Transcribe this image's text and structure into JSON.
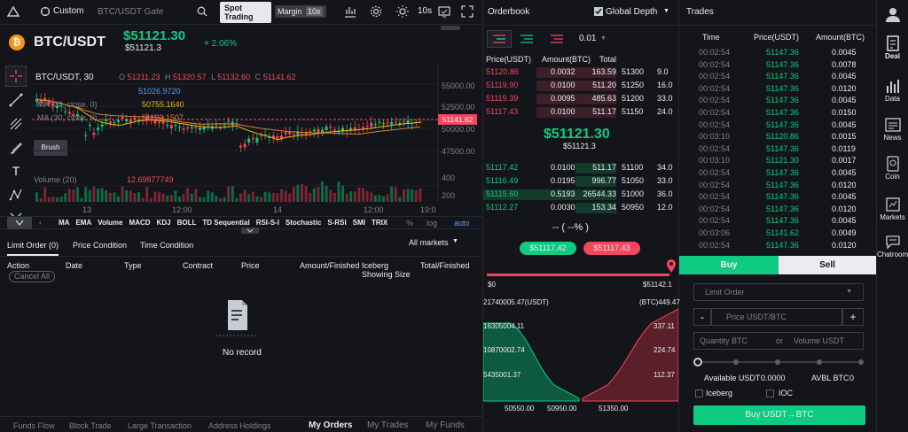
{
  "topbar": {
    "custom": "Custom",
    "symbol_search": "BTC/USDT Gate",
    "spot_trading": "Spot Trading",
    "margin": "Margin",
    "margin_badge": "10x",
    "interval": "10s"
  },
  "ticker": {
    "pair": "BTC/USDT",
    "price": "$51121.30",
    "sub": "$51121.3",
    "change": "+ 2.06%"
  },
  "chart": {
    "title": "BTC/USDT, 30",
    "o": "O",
    "o_val": "51211.23",
    "h": "H",
    "h_val": "51320.57",
    "l": "L",
    "l_val": "51132.60",
    "c": "C",
    "c_val": "51141.62",
    "ind1_val": "51026.9720",
    "ma10_label": "MA (10, close, 0)",
    "ma10_val": "50755.1640",
    "ma30_label": "MA (30, close, 0)",
    "ma30_val": "51129.1507",
    "vol_label": "Volume (20)",
    "vol_val": "12.69877749",
    "price_tag": "51141.62",
    "y_ticks": [
      "55000.00",
      "52500.00",
      "50000.00",
      "47500.00"
    ],
    "vol_ticks": [
      "400",
      "200"
    ],
    "x_ticks": [
      "13",
      "12:00",
      "14",
      "12:00",
      "19:0"
    ],
    "tooltip": "Brush"
  },
  "indicators": [
    "MA",
    "EMA",
    "Volume",
    "MACD",
    "KDJ",
    "BOLL",
    "TD Sequential",
    "RSI-S-I",
    "Stochastic",
    "S-RSI",
    "SMI",
    "TRIX"
  ],
  "chart_opts": [
    "%",
    "log",
    "auto"
  ],
  "orders": {
    "tabs": [
      "Limit Order (0)",
      "Price Condition",
      "Time Condition"
    ],
    "all_markets": "All markets",
    "cols": [
      "Action",
      "Date",
      "Type",
      "Contract",
      "Price",
      "Amount/Finished",
      "Iceberg Showing Size",
      "Total/Finished"
    ],
    "cancel_all": "Cancel All",
    "no_record": "No record"
  },
  "bottom_nav": [
    "Funds Flow",
    "Block Trade",
    "Large Transaction",
    "Address Holdings",
    "My Orders",
    "My Trades",
    "My Funds"
  ],
  "orderbook": {
    "title": "Orderbook",
    "global_depth": "Global Depth",
    "precision": "0.01",
    "headers": [
      "Price(USDT)",
      "Amount(BTC)",
      "Total"
    ],
    "asks": [
      [
        "51120.86",
        "0.0032",
        "163.59",
        "51300",
        "9.0"
      ],
      [
        "51119.90",
        "0.0100",
        "511.20",
        "51250",
        "16.0"
      ],
      [
        "51119.39",
        "0.0095",
        "485.63",
        "51200",
        "33.0"
      ],
      [
        "51117.43",
        "0.0100",
        "511.17",
        "51150",
        "24.0"
      ]
    ],
    "mid": "$51121.30",
    "mid_sub": "$51121.3",
    "bids": [
      [
        "51117.42",
        "0.0100",
        "511.17",
        "51100",
        "34.0"
      ],
      [
        "51116.49",
        "0.0195",
        "996.77",
        "51050",
        "33.0"
      ],
      [
        "51115.60",
        "0.5193",
        "26544.33",
        "51000",
        "36.0"
      ],
      [
        "51112.27",
        "0.0030",
        "153.34",
        "50950",
        "12.0"
      ]
    ],
    "pct": "-- ( --% )",
    "bid_btn": "$51117.42",
    "ask_btn": "$51117.43",
    "bar_left": "$0",
    "bar_right": "$51142.1"
  },
  "depth": {
    "left_top": "21740005.47(USDT)",
    "right_top": "(BTC)449.47",
    "left_ticks": [
      "16305004.11",
      "10870002.74",
      "5435001.37"
    ],
    "right_ticks": [
      "337.11",
      "224.74",
      "112.37"
    ],
    "x_ticks": [
      "50550.00",
      "50950.00",
      "51350.00"
    ],
    "bid_color": "#0ecb81",
    "ask_color": "#f6465d"
  },
  "trades": {
    "title": "Trades",
    "headers": [
      "Time",
      "Price(USDT)",
      "Amount(BTC)"
    ],
    "rows": [
      [
        "00:02:54",
        "51147.36",
        "0.0045"
      ],
      [
        "00:02:54",
        "51147.36",
        "0.0078"
      ],
      [
        "00:02:54",
        "51147.36",
        "0.0045"
      ],
      [
        "00:02:54",
        "51147.36",
        "0.0120"
      ],
      [
        "00:02:54",
        "51147.36",
        "0.0045"
      ],
      [
        "00:02:54",
        "51147.36",
        "0.0150"
      ],
      [
        "00:02:54",
        "51147.36",
        "0.0045"
      ],
      [
        "00:03:10",
        "51120.86",
        "0.0015"
      ],
      [
        "00:02:54",
        "51147.36",
        "0.0119"
      ],
      [
        "00:03:10",
        "51121.30",
        "0.0017"
      ],
      [
        "00:02:54",
        "51147.36",
        "0.0045"
      ],
      [
        "00:02:54",
        "51147.36",
        "0.0120"
      ],
      [
        "00:02:54",
        "51147.36",
        "0.0045"
      ],
      [
        "00:02:54",
        "51147.36",
        "0.0120"
      ],
      [
        "00:02:54",
        "51147.36",
        "0.0045"
      ],
      [
        "00:03:06",
        "51141.62",
        "0.0049"
      ],
      [
        "00:02:54",
        "51147.36",
        "0.0120"
      ]
    ]
  },
  "form": {
    "buy": "Buy",
    "sell": "Sell",
    "order_type": "Limit Order",
    "minus": "-",
    "plus": "+",
    "price_ph": "Price USDT/BTC",
    "qty_ph": "Quantity BTC",
    "or": "or",
    "vol_ph": "Volume USDT",
    "available": "Available USDT",
    "available_val": "0.0000",
    "avbl": "AVBL BTC",
    "avbl_val": "0",
    "iceberg": "Iceberg",
    "ioc": "IOC",
    "submit": "Buy USDT→BTC"
  },
  "sidebar": [
    "Deal",
    "Data",
    "News",
    "Coin",
    "Markets",
    "Chatroom"
  ],
  "colors": {
    "up": "#0ecb81",
    "down": "#f6465d",
    "accent": "#f0b90b",
    "bg": "#14151a"
  }
}
